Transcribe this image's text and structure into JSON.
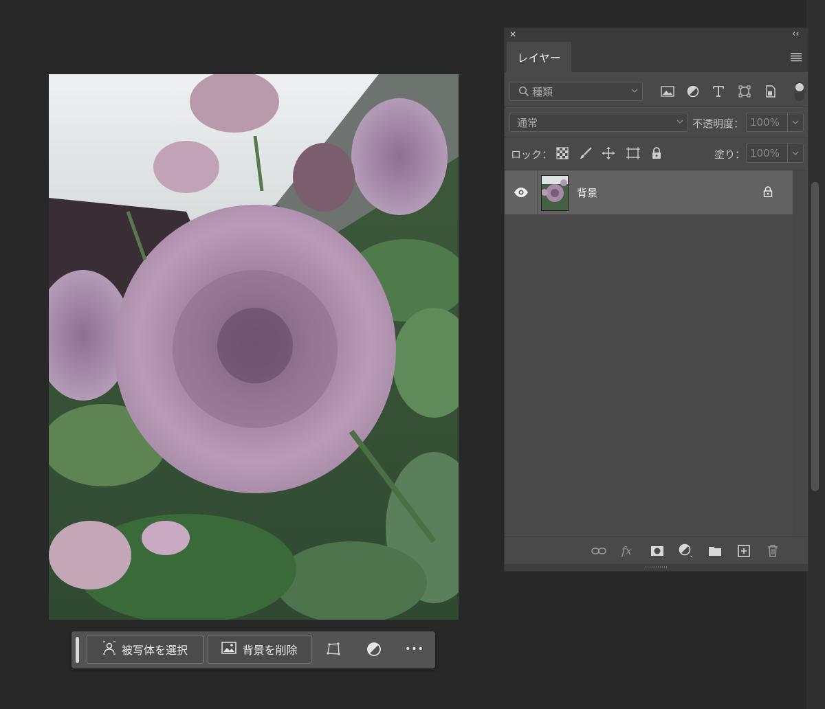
{
  "canvas": {
    "image_label": "rose-photo"
  },
  "taskbar": {
    "select_subject_label": "被写体を選択",
    "remove_background_label": "背景を削除",
    "more_label": "•••"
  },
  "layers_panel": {
    "tab_title": "レイヤー",
    "collapse_label": "‹‹",
    "close_label": "✕",
    "filter": {
      "placeholder": "種類"
    },
    "blend_mode": {
      "value": "通常"
    },
    "opacity": {
      "label": "不透明度：",
      "value": "100%"
    },
    "lock": {
      "label": "ロック："
    },
    "fill": {
      "label": "塗り：",
      "value": "100%"
    },
    "layers": [
      {
        "name": "背景",
        "visible": true,
        "locked": true
      }
    ]
  },
  "colors": {
    "app_background": "#282828",
    "panel": "#494949",
    "selected_layer": "#626262"
  }
}
